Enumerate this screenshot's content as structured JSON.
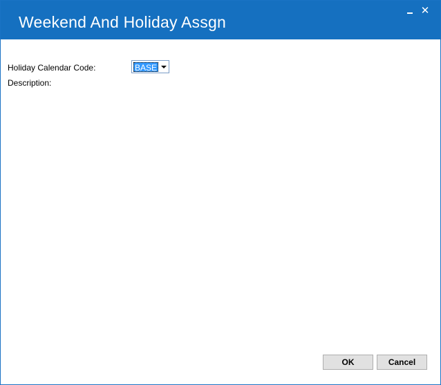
{
  "window": {
    "title": "Weekend And Holiday Assgn",
    "close_glyph": "✕"
  },
  "form": {
    "holiday_calendar_code_label": "Holiday Calendar Code:",
    "holiday_calendar_code_value": "BASE",
    "description_label": "Description:"
  },
  "buttons": {
    "ok_label": "OK",
    "cancel_label": "Cancel"
  },
  "colors": {
    "titlebar": "#1570c0",
    "selection": "#3399ff"
  },
  "icons": {
    "minimize": "minimize-icon",
    "close": "close-icon",
    "dropdown": "chevron-down-icon"
  }
}
